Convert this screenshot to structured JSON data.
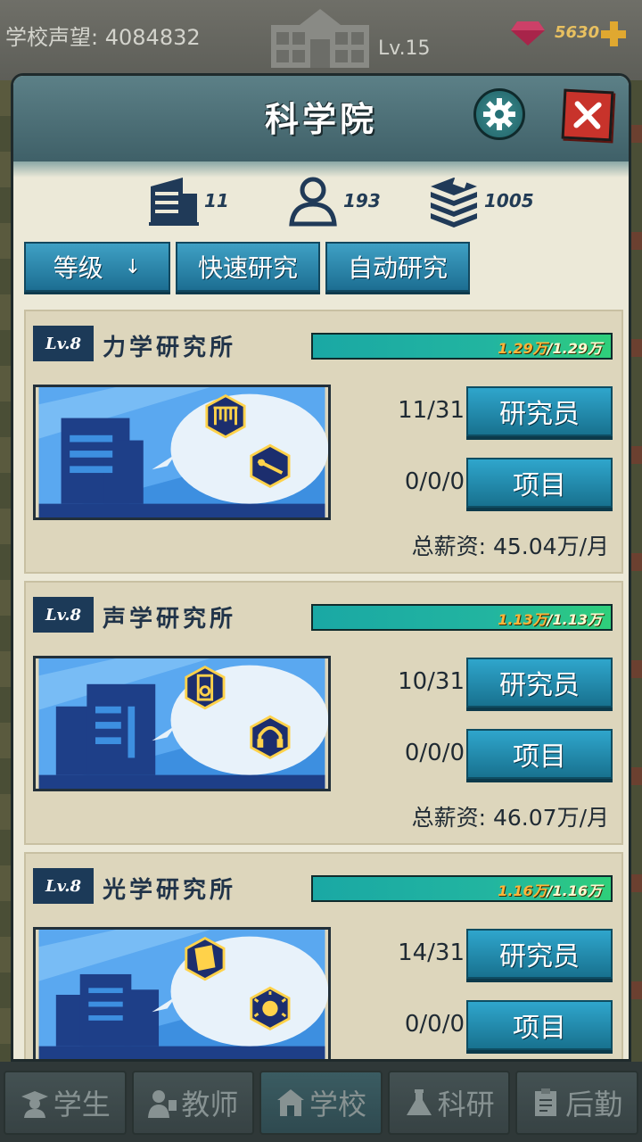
{
  "topbar": {
    "reputation_label": "学校声望:",
    "reputation_value": "4084832",
    "level": "Lv.15",
    "gems": "5630"
  },
  "modal": {
    "title": "科学院",
    "stats": [
      {
        "icon": "building-icon",
        "value": "11"
      },
      {
        "icon": "person-icon",
        "value": "193"
      },
      {
        "icon": "books-icon",
        "value": "1005"
      }
    ],
    "sort_button": {
      "label": "等级",
      "arrow": "↓"
    },
    "quick_research_label": "快速研究",
    "auto_research_label": "自动研究"
  },
  "institutes": [
    {
      "level": "Lv.8",
      "name": "力学研究所",
      "progress_current": "1.29万",
      "progress_max": "/1.29万",
      "progress_fraction": 1.0,
      "researchers": "11/31",
      "researcher_button": "研究员",
      "projects": "0/0/0",
      "project_button": "项目",
      "salary": "总薪资: 45.04万/月",
      "icons": [
        "pendulum-icon",
        "lever-icon"
      ]
    },
    {
      "level": "Lv.8",
      "name": "声学研究所",
      "progress_current": "1.13万",
      "progress_max": "/1.13万",
      "progress_fraction": 1.0,
      "researchers": "10/31",
      "researcher_button": "研究员",
      "projects": "0/0/0",
      "project_button": "项目",
      "salary": "总薪资: 46.07万/月",
      "icons": [
        "speaker-icon",
        "headphones-icon"
      ]
    },
    {
      "level": "Lv.8",
      "name": "光学研究所",
      "progress_current": "1.16万",
      "progress_max": "/1.16万",
      "progress_fraction": 1.0,
      "researchers": "14/31",
      "researcher_button": "研究员",
      "projects": "0/0/0",
      "project_button": "项目",
      "salary": "",
      "icons": [
        "prism-icon",
        "lightbulb-icon"
      ]
    }
  ],
  "bottom_nav": [
    {
      "label": "学生",
      "icon": "student-icon",
      "active": false
    },
    {
      "label": "教师",
      "icon": "teacher-icon",
      "active": false
    },
    {
      "label": "学校",
      "icon": "school-icon",
      "active": true
    },
    {
      "label": "科研",
      "icon": "flask-icon",
      "active": false
    },
    {
      "label": "后勤",
      "icon": "clipboard-icon",
      "active": false
    }
  ],
  "colors": {
    "accent_button": "#1c7a9c",
    "close_button": "#c8332b",
    "badge": "#1c3a58",
    "progress": "#22b5a0"
  }
}
